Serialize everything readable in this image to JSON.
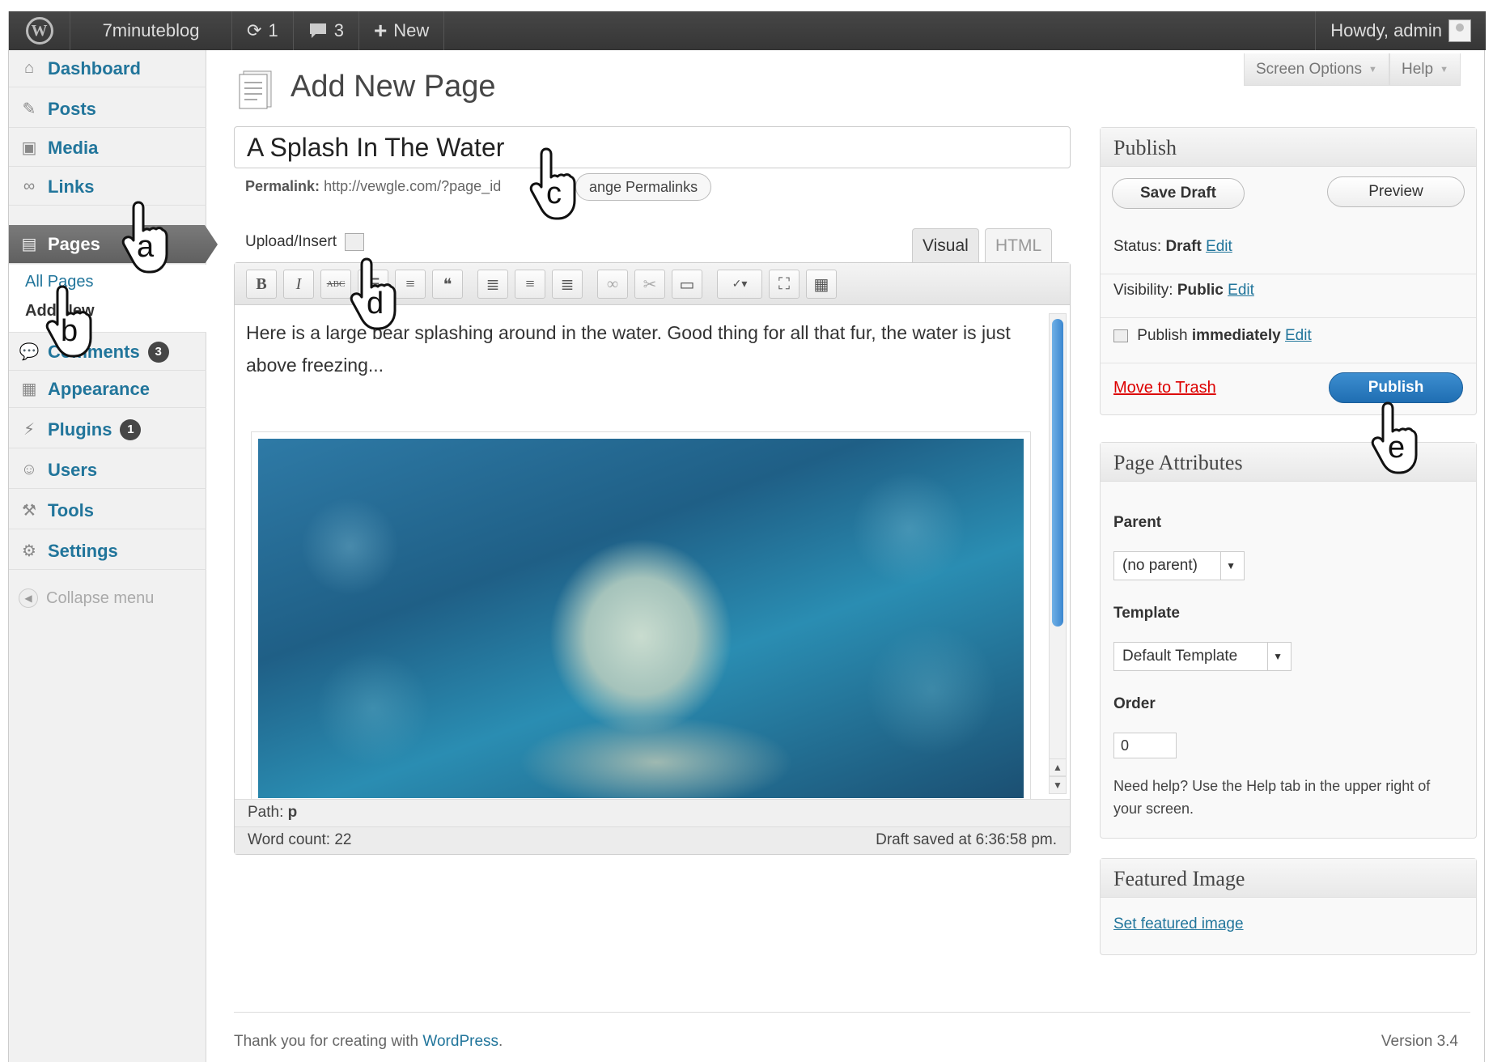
{
  "admin_bar": {
    "site_name": "7minuteblog",
    "updates_count": "1",
    "comments_count": "3",
    "new_label": "New",
    "howdy": "Howdy, admin"
  },
  "sidebar": {
    "items": [
      {
        "label": "Dashboard",
        "icon": "home-icon"
      },
      {
        "label": "Posts",
        "icon": "pin-icon"
      },
      {
        "label": "Media",
        "icon": "media-icon"
      },
      {
        "label": "Links",
        "icon": "link-icon"
      },
      {
        "label": "Pages",
        "icon": "pages-icon"
      },
      {
        "label": "Comments",
        "icon": "comment-icon",
        "badge": "3"
      },
      {
        "label": "Appearance",
        "icon": "appearance-icon"
      },
      {
        "label": "Plugins",
        "icon": "plugin-icon",
        "badge": "1"
      },
      {
        "label": "Users",
        "icon": "users-icon"
      },
      {
        "label": "Tools",
        "icon": "tools-icon"
      },
      {
        "label": "Settings",
        "icon": "settings-icon"
      }
    ],
    "submenu": {
      "all_pages": "All Pages",
      "add_new": "Add New"
    },
    "collapse": "Collapse menu"
  },
  "header": {
    "title": "Add New Page",
    "screen_options": "Screen Options",
    "help": "Help"
  },
  "editor": {
    "title_value": "A Splash In The Water",
    "permalink_label": "Permalink:",
    "permalink_url": "http://vewgle.com/?page_id",
    "change_permalinks": "ange Permalinks",
    "upload_insert": "Upload/Insert",
    "tab_visual": "Visual",
    "tab_html": "HTML",
    "toolbar": [
      "B",
      "I",
      "ABC"
    ],
    "content": "Here is a large bear splashing around in the water.  Good thing for all that fur, the water is just above freezing...",
    "path_label": "Path:",
    "path_value": "p",
    "word_count": "Word count: 22",
    "draft_saved": "Draft saved at 6:36:58 pm."
  },
  "publish": {
    "title": "Publish",
    "save_draft": "Save Draft",
    "preview": "Preview",
    "status_label": "Status:",
    "status_value": "Draft",
    "visibility_label": "Visibility:",
    "visibility_value": "Public",
    "publish_label": "Publish",
    "publish_value": "immediately",
    "edit": "Edit",
    "move_to_trash": "Move to Trash",
    "publish_button": "Publish"
  },
  "page_attributes": {
    "title": "Page Attributes",
    "parent_label": "Parent",
    "parent_value": "(no parent)",
    "template_label": "Template",
    "template_value": "Default Template",
    "order_label": "Order",
    "order_value": "0",
    "help": "Need help? Use the Help tab in the upper right of your screen."
  },
  "featured_image": {
    "title": "Featured Image",
    "link": "Set featured image"
  },
  "footer": {
    "thanks_prefix": "Thank you for creating with ",
    "wordpress": "WordPress",
    "suffix": ".",
    "version": "Version 3.4"
  },
  "callouts": [
    "a",
    "b",
    "c",
    "d",
    "e"
  ],
  "colors": {
    "admin_bar": "#464646",
    "link": "#21759b",
    "publish_button": "#2a7fc4",
    "trash": "#dd0000"
  }
}
